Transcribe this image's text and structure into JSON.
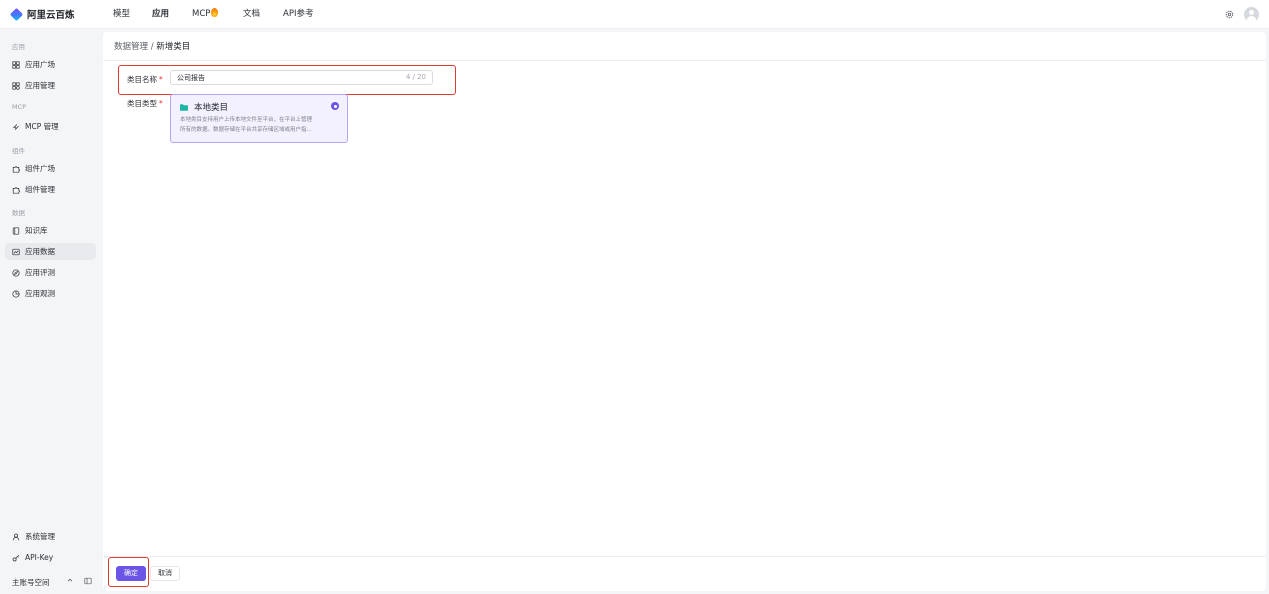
{
  "brand": {
    "name": "阿里云百炼"
  },
  "topnav": [
    {
      "label": "模型"
    },
    {
      "label": "应用"
    },
    {
      "label": "MCP"
    },
    {
      "label": "文档"
    },
    {
      "label": "API参考"
    }
  ],
  "sidebar": {
    "sections": [
      {
        "title": "应用",
        "items": [
          {
            "label": "应用广场",
            "icon": "grid-icon"
          },
          {
            "label": "应用管理",
            "icon": "grid-icon"
          }
        ]
      },
      {
        "title": "MCP",
        "items": [
          {
            "label": "MCP 管理",
            "icon": "mcp-icon"
          }
        ]
      },
      {
        "title": "组件",
        "items": [
          {
            "label": "组件广场",
            "icon": "puzzle-icon"
          },
          {
            "label": "组件管理",
            "icon": "puzzle-icon"
          }
        ]
      },
      {
        "title": "数据",
        "items": [
          {
            "label": "知识库",
            "icon": "book-icon"
          },
          {
            "label": "应用数据",
            "icon": "chart-icon"
          },
          {
            "label": "应用评测",
            "icon": "compass-icon"
          },
          {
            "label": "应用观测",
            "icon": "pie-icon"
          }
        ]
      }
    ],
    "bottom": [
      {
        "label": "系统管理",
        "icon": "user-icon"
      },
      {
        "label": "API-Key",
        "icon": "key-icon"
      }
    ],
    "workspace": "主账号空间"
  },
  "breadcrumb": {
    "parent": "数据管理",
    "separator": "/",
    "current": "新增类目"
  },
  "form": {
    "name_label": "类目名称",
    "name_value": "公司报告",
    "name_count": "4 / 20",
    "type_label": "类目类型",
    "type_option": {
      "title": "本地类目",
      "desc_line1": "本地类目支持用户上传本地文件至平台，在平台上管理",
      "desc_line2": "所有的数据。数据存储在平台共享存储区域或用户指..."
    }
  },
  "actions": {
    "ok": "确定",
    "cancel": "取消"
  },
  "colors": {
    "primary": "#6b55e6",
    "highlight": "#e23b30"
  }
}
